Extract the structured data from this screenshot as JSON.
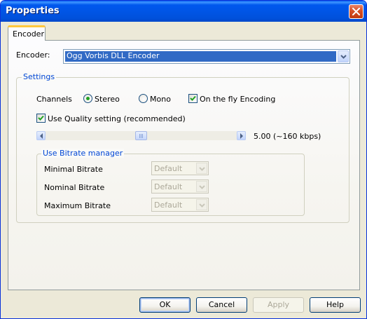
{
  "window": {
    "title": "Properties"
  },
  "tabs": [
    {
      "label": "Encoder",
      "active": true
    }
  ],
  "encoder": {
    "label": "Encoder:",
    "value": "Ogg Vorbis DLL Encoder"
  },
  "settings": {
    "title": "Settings",
    "channels_label": "Channels",
    "stereo_label": "Stereo",
    "stereo_selected": true,
    "mono_label": "Mono",
    "mono_selected": false,
    "on_the_fly_label": "On the fly Encoding",
    "on_the_fly_checked": true,
    "use_quality_label": "Use Quality setting (recommended)",
    "use_quality_checked": true,
    "quality_readout": "5.00 (~160 kbps)",
    "quality_slider_fraction": 0.5
  },
  "bitrate_manager": {
    "title": "Use Bitrate manager",
    "rows": [
      {
        "label": "Minimal Bitrate",
        "value": "Default"
      },
      {
        "label": "Nominal Bitrate",
        "value": "Default"
      },
      {
        "label": "Maximum Bitrate",
        "value": "Default"
      }
    ]
  },
  "buttons": {
    "ok": "OK",
    "cancel": "Cancel",
    "apply": "Apply",
    "help": "Help"
  },
  "colors": {
    "title_bar": "#0054E3",
    "dialog_bg": "#ECE9D8",
    "selection": "#316AC5",
    "group_title": "#0046D5",
    "checkmark": "#21A121"
  }
}
